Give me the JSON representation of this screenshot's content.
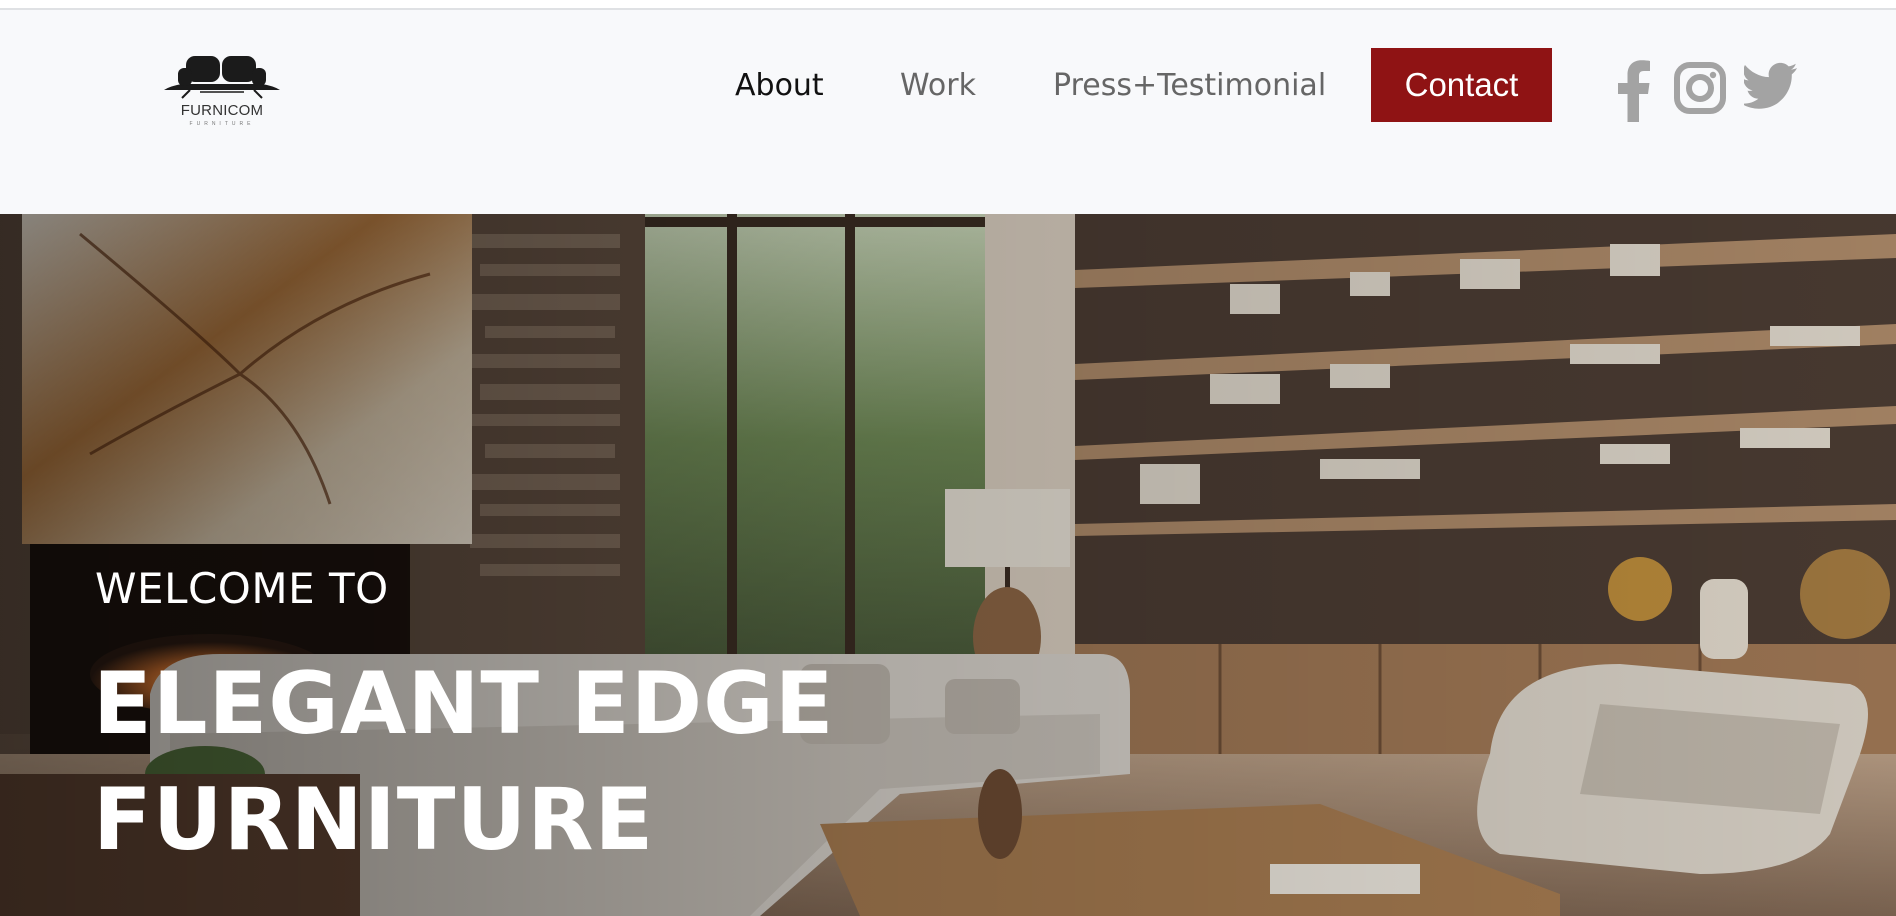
{
  "brand": {
    "name": "FURNICOM",
    "tagline": "FURNITURE"
  },
  "nav": {
    "items": [
      {
        "label": "About",
        "active": true
      },
      {
        "label": "Work",
        "active": false
      },
      {
        "label": "Press+Testimonial",
        "active": false
      }
    ],
    "contact_label": "Contact"
  },
  "social": [
    "facebook-icon",
    "instagram-icon",
    "twitter-icon"
  ],
  "hero": {
    "welcome": "WELCOME TO",
    "title_line1": "ELEGANT EDGE",
    "title_line2": "FURNITURE"
  },
  "colors": {
    "accent": "#8f1314",
    "header_bg": "#f8f9fb",
    "nav_text": "#666666",
    "nav_active": "#111111",
    "social_icon": "#a3a3a3"
  }
}
